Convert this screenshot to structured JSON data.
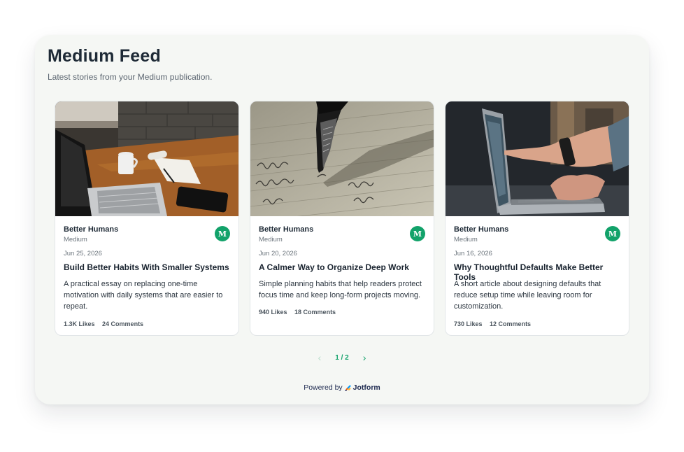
{
  "header": {
    "title": "Medium Feed",
    "subtitle": "Latest stories from your Medium publication."
  },
  "cards": [
    {
      "image": "laptop-coffee-desk-photo",
      "publication": "Better Humans",
      "source": "Medium",
      "badge": "M",
      "date": "Jun 25, 2026",
      "title": "Build Better Habits With Smaller Systems",
      "excerpt": "A practical essay on replacing one-time motivation with daily systems that are easier to repeat.",
      "likes": "1.3K Likes",
      "comments": "24 Comments"
    },
    {
      "image": "fountain-pen-writing-photo",
      "publication": "Better Humans",
      "source": "Medium",
      "badge": "M",
      "date": "Jun 20, 2026",
      "title": "A Calmer Way to Organize Deep Work",
      "excerpt": "Simple planning habits that help readers protect focus time and keep long-form projects moving.",
      "likes": "940 Likes",
      "comments": "18 Comments"
    },
    {
      "image": "pointing-at-laptop-photo",
      "publication": "Better Humans",
      "source": "Medium",
      "badge": "M",
      "date": "Jun 16, 2026",
      "title": "Why Thoughtful Defaults Make Better Tools",
      "excerpt": "A short article about designing defaults that reduce setup time while leaving room for customization.",
      "likes": "730 Likes",
      "comments": "12 Comments"
    }
  ],
  "pagination": {
    "prev_icon": "chevron-left-icon",
    "page_label": "1 / 2",
    "next_icon": "chevron-right-icon"
  },
  "footer": {
    "powered_by": "Powered by",
    "brand": "Jotform"
  },
  "colors": {
    "accent": "#12a26a",
    "background": "#f5f7f4",
    "card": "#ffffff",
    "text": "#1e2a36"
  }
}
